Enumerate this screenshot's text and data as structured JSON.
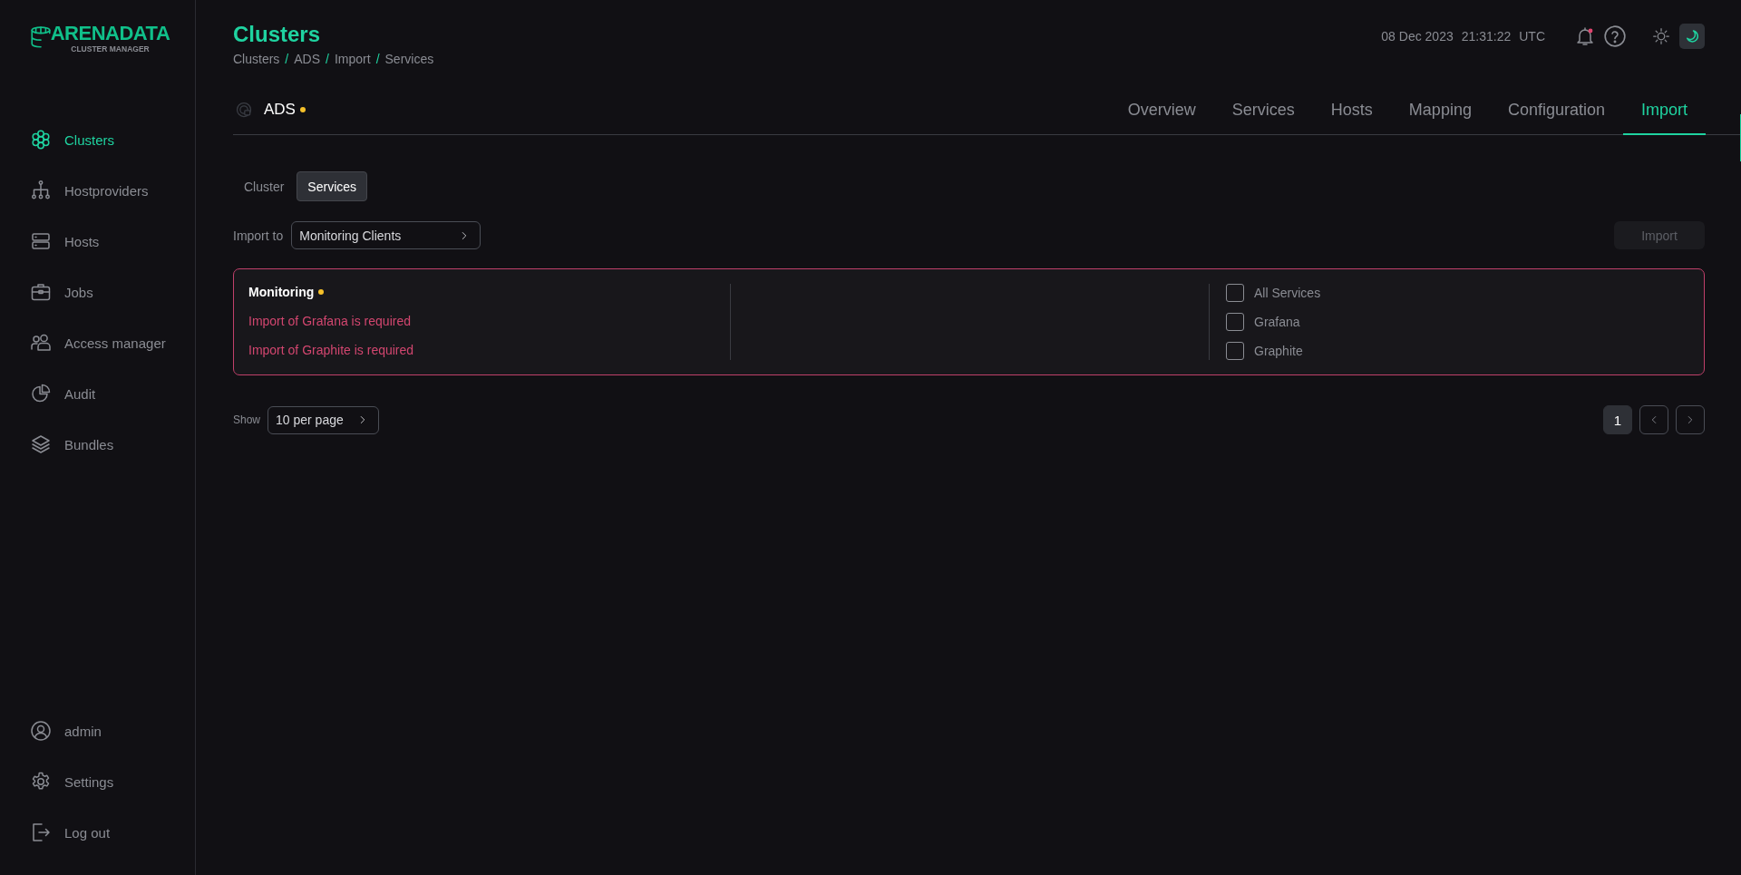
{
  "logo": {
    "title": "ARENADATA",
    "subtitle": "CLUSTER MANAGER"
  },
  "sidebar": {
    "items": [
      {
        "label": "Clusters",
        "selected": true
      },
      {
        "label": "Hostproviders",
        "selected": false
      },
      {
        "label": "Hosts",
        "selected": false
      },
      {
        "label": "Jobs",
        "selected": false
      },
      {
        "label": "Access manager",
        "selected": false
      },
      {
        "label": "Audit",
        "selected": false
      },
      {
        "label": "Bundles",
        "selected": false
      }
    ],
    "bottom_items": [
      {
        "label": "admin"
      },
      {
        "label": "Settings"
      },
      {
        "label": "Log out"
      }
    ]
  },
  "header": {
    "title": "Clusters",
    "breadcrumbs": [
      "Clusters",
      "ADS",
      "Import",
      "Services"
    ],
    "breadcrumb_separator": "/",
    "date": "08 Dec 2023",
    "time": "21:31:22",
    "timezone": "UTC",
    "notifications_unread": true,
    "theme_toggle": [
      {
        "kind": "light",
        "selected": false
      },
      {
        "kind": "dark",
        "selected": true
      }
    ]
  },
  "entity": {
    "name": "ADS",
    "concern": true
  },
  "tabs": [
    {
      "label": "Overview",
      "selected": false
    },
    {
      "label": "Services",
      "selected": false
    },
    {
      "label": "Hosts",
      "selected": false
    },
    {
      "label": "Mapping",
      "selected": false
    },
    {
      "label": "Configuration",
      "selected": false
    },
    {
      "label": "Import",
      "selected": true
    }
  ],
  "subtabs": [
    {
      "label": "Cluster",
      "selected": false
    },
    {
      "label": "Services",
      "selected": true
    }
  ],
  "import_to": {
    "label": "Import to",
    "value": "Monitoring Clients"
  },
  "import_button": {
    "label": "Import",
    "disabled": true
  },
  "import_cards": [
    {
      "title": "Monitoring",
      "concern": true,
      "invalid": true,
      "errors": [
        "Import of Grafana is required",
        "Import of Graphite is required"
      ],
      "options": [
        {
          "label": "All Services",
          "checked": false
        },
        {
          "label": "Grafana",
          "checked": false
        },
        {
          "label": "Graphite",
          "checked": false
        }
      ]
    }
  ],
  "pagination": {
    "show_label": "Show",
    "per_page": "10 per page",
    "pages": [
      {
        "label": "1",
        "selected": true
      }
    ]
  }
}
